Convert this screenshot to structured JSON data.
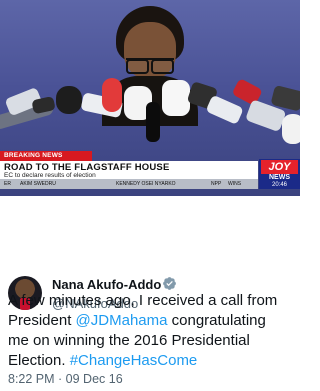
{
  "video": {
    "breaking_label": "BREAKING NEWS",
    "headline": "ROAD TO THE FLAGSTAFF HOUSE",
    "subline": "EC to declare results of election",
    "ticker": [
      "ER",
      "AKIM SWEDRU",
      "KENNEDY OSEI NYARKO",
      "NPP",
      "WINS"
    ],
    "channel_logo": "JOY",
    "channel_news": "NEWS",
    "clock": "20:46",
    "colors": {
      "breaking_red": "#d71920",
      "joy_blue": "#1b2a88",
      "joy_red": "#e5222b"
    }
  },
  "tweet": {
    "display_name": "Nana Akufo-Addo",
    "verified_icon": "verified-badge-icon",
    "handle": "@NAkufoAddo",
    "text_lines": [
      {
        "before": "A few minutes ago, I received a call from",
        "link": "",
        "after": ""
      },
      {
        "before": "President ",
        "link": "@JDMahama",
        "after": " congratulating"
      },
      {
        "before": "me on winning the 2016 Presidential",
        "link": "",
        "after": ""
      },
      {
        "before": "Election. ",
        "link": "#ChangeHasCome",
        "after": ""
      }
    ],
    "timestamp": "8:22 PM · 09 Dec 16",
    "link_color": "#1d9bf0"
  }
}
